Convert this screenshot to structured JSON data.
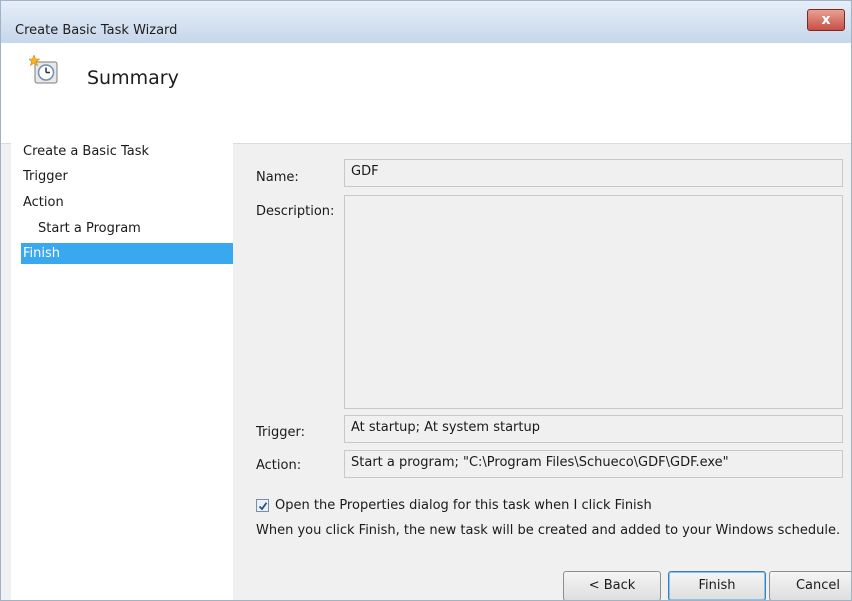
{
  "window": {
    "title": "Create Basic Task Wizard",
    "close_label": "x"
  },
  "header": {
    "title": "Summary",
    "icon": "scheduled-task-clock-icon"
  },
  "nav": {
    "items": [
      {
        "label": "Create a Basic Task"
      },
      {
        "label": "Trigger"
      },
      {
        "label": "Action"
      },
      {
        "label": "Start a Program"
      },
      {
        "label": "Finish"
      }
    ],
    "selected": "Finish"
  },
  "summary": {
    "name_label": "Name:",
    "name_value": "GDF",
    "description_label": "Description:",
    "description_value": "",
    "trigger_label": "Trigger:",
    "trigger_value": "At startup; At system startup",
    "action_label": "Action:",
    "action_value": "Start a program; \"C:\\Program Files\\Schueco\\GDF\\GDF.exe\""
  },
  "options": {
    "open_properties_label": "Open the Properties dialog for this task when I click Finish",
    "open_properties_checked": true,
    "note": "When you click Finish, the new task will be created and added to your Windows schedule."
  },
  "buttons": {
    "back": "< Back",
    "finish": "Finish",
    "cancel": "Cancel"
  },
  "colors": {
    "selection": "#39a8ee"
  }
}
